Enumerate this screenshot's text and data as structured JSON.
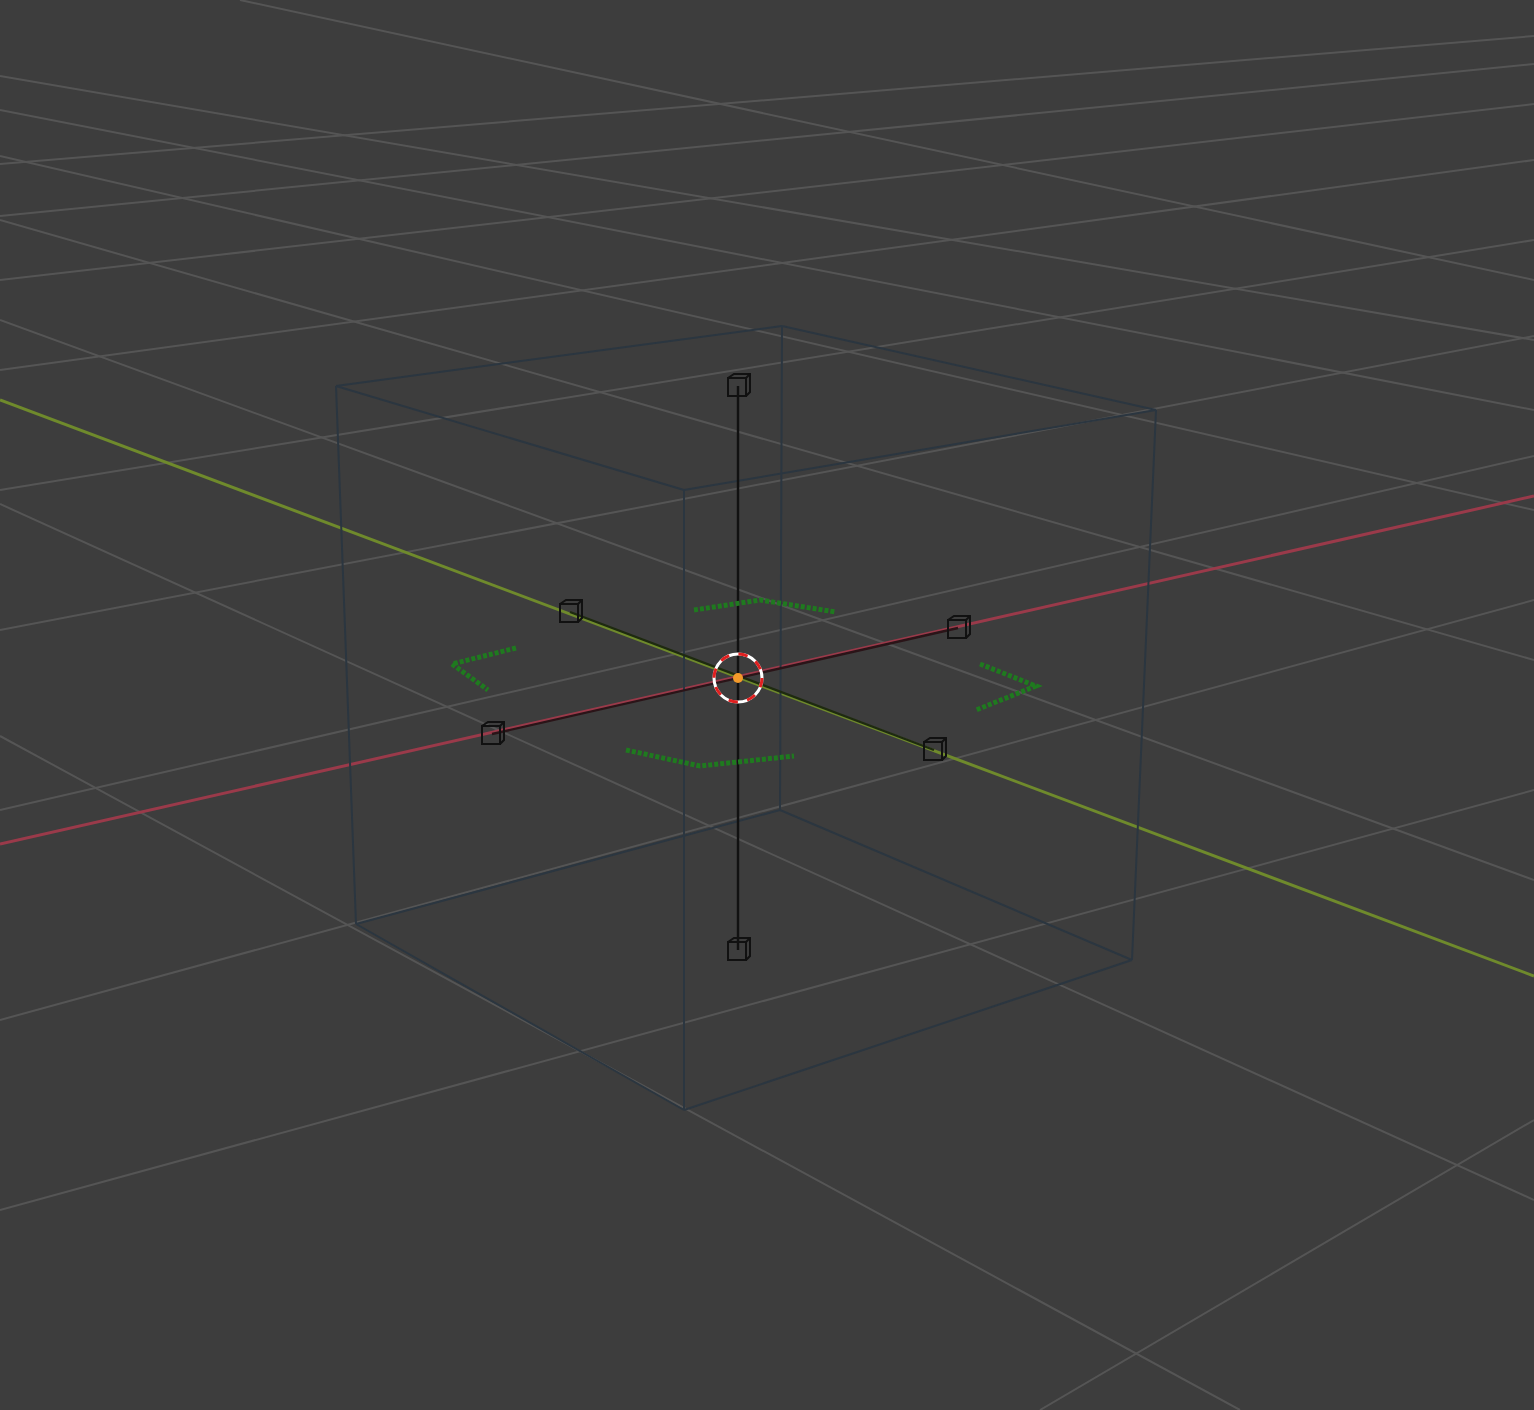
{
  "viewport": {
    "grid": true,
    "objects": [
      {
        "kind": "cube-wireframe"
      },
      {
        "kind": "cursor"
      }
    ]
  }
}
